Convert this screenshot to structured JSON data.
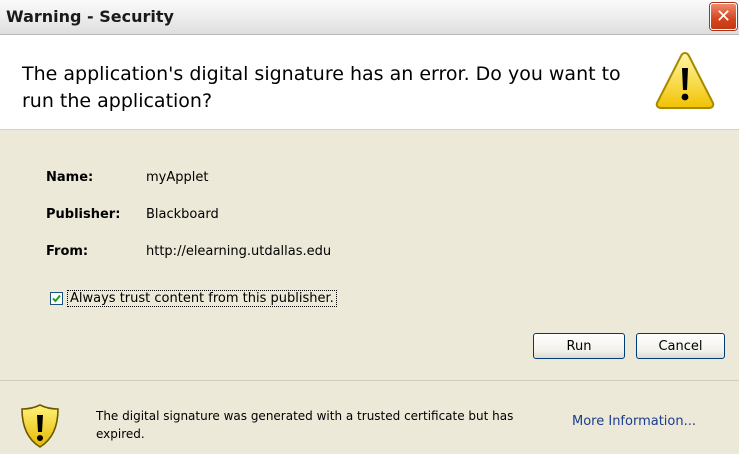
{
  "window": {
    "title": "Warning - Security",
    "close_symbol": "✕"
  },
  "header": {
    "message": "The application's digital signature has an error.  Do you want to run the application?",
    "icon": "warning-triangle-icon"
  },
  "details": {
    "name_label": "Name:",
    "name_value": "myApplet",
    "publisher_label": "Publisher:",
    "publisher_value": "Blackboard",
    "from_label": "From:",
    "from_value": "http://elearning.utdallas.edu"
  },
  "trust_checkbox": {
    "label": "Always trust content from this publisher.",
    "checked": true
  },
  "buttons": {
    "run": "Run",
    "cancel": "Cancel"
  },
  "footer": {
    "icon": "warning-shield-icon",
    "message": "The digital signature was generated with a trusted certificate but has expired.",
    "more_info": "More Information..."
  }
}
